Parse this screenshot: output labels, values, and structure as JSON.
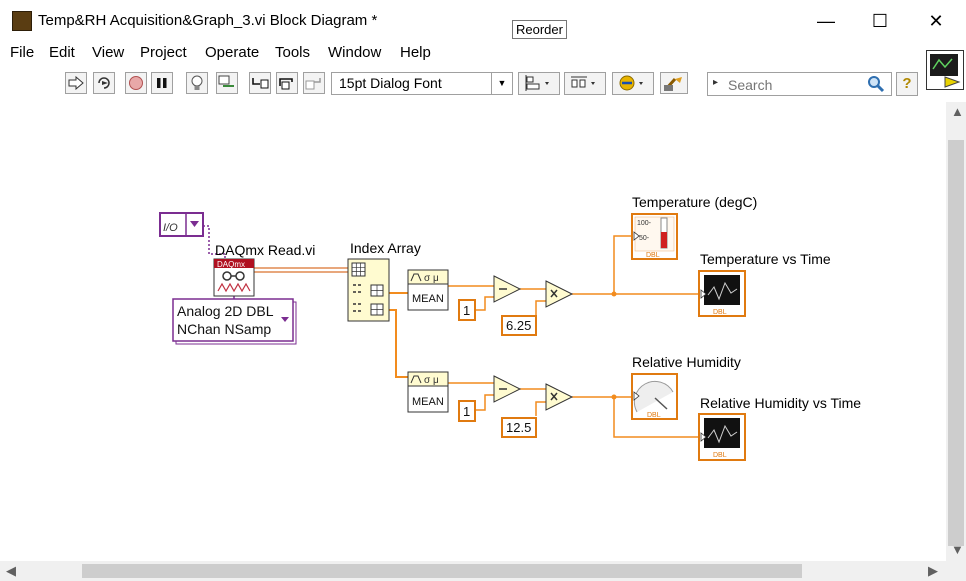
{
  "window": {
    "title": "Temp&RH Acquisition&Graph_3.vi Block Diagram *",
    "minimize": "—",
    "maximize": "☐",
    "close": "✕"
  },
  "tooltip": "Reorder",
  "menu": [
    "File",
    "Edit",
    "View",
    "Project",
    "Operate",
    "Tools",
    "Window",
    "Help"
  ],
  "toolbar": {
    "font": "15pt Dialog Font",
    "search_placeholder": "Search",
    "help": "?"
  },
  "diagram": {
    "task_constant": "I/O",
    "daqmx_read": {
      "label": "DAQmx Read.vi",
      "banner": "DAQmx"
    },
    "read_selector": {
      "line1": "Analog 2D DBL",
      "line2": "NChan NSamp"
    },
    "index_array": "Index Array",
    "mean1": "MEAN",
    "mean2": "MEAN",
    "const_1a": "1",
    "const_1b": "1",
    "scale_temp": "6.25",
    "scale_rh": "12.5",
    "temp_label": "Temperature (degC)",
    "temp_thermo_100": "100-",
    "temp_thermo_50": "50-",
    "temp_graph_label": "Temperature vs Time",
    "rh_label": "Relative Humidity",
    "rh_graph_label": "Relative Humidity vs Time",
    "dbl": "DBL"
  },
  "colors": {
    "wire_orange": "#f28c1e",
    "wire_purple": "#7b2d91",
    "wire_pink": "#c06090",
    "terminal_border": "#e07a10"
  }
}
